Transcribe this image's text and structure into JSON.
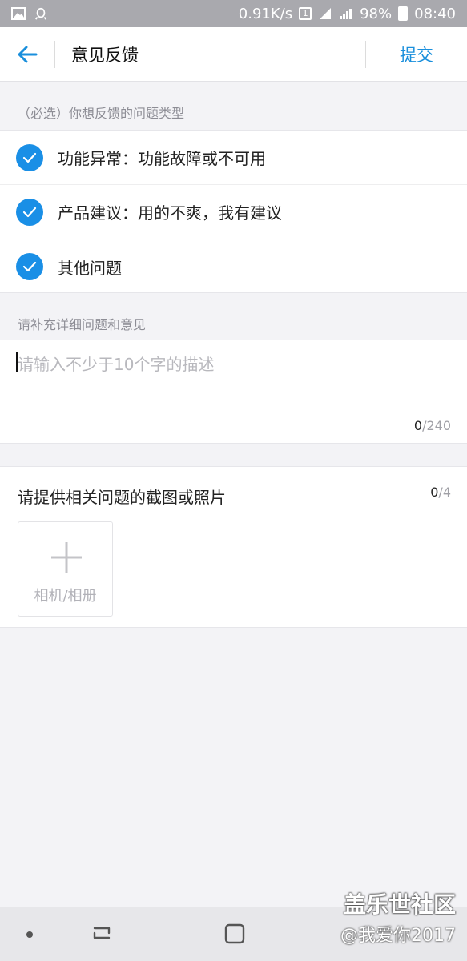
{
  "status_bar": {
    "speed": "0.91K/s",
    "sim": "1",
    "network": "4G",
    "battery": "98%",
    "time": "08:40"
  },
  "header": {
    "title": "意见反馈",
    "submit_label": "提交"
  },
  "type_section": {
    "label": "（必选）你想反馈的问题类型",
    "options": [
      {
        "label": "功能异常：功能故障或不可用",
        "checked": true
      },
      {
        "label": "产品建议：用的不爽，我有建议",
        "checked": true
      },
      {
        "label": "其他问题",
        "checked": true
      }
    ]
  },
  "detail_section": {
    "label": "请补充详细问题和意见",
    "placeholder": "请输入不少于10个字的描述",
    "count_current": "0",
    "count_max": "/240"
  },
  "photo_section": {
    "title": "请提供相关问题的截图或照片",
    "count_current": "0",
    "count_max": "/4",
    "add_label": "相机/相册"
  },
  "watermark": {
    "line1": "盖乐世社区",
    "line2": "@我爱你2017"
  },
  "colors": {
    "accent": "#1a8fe6",
    "background": "#f3f3f6"
  }
}
